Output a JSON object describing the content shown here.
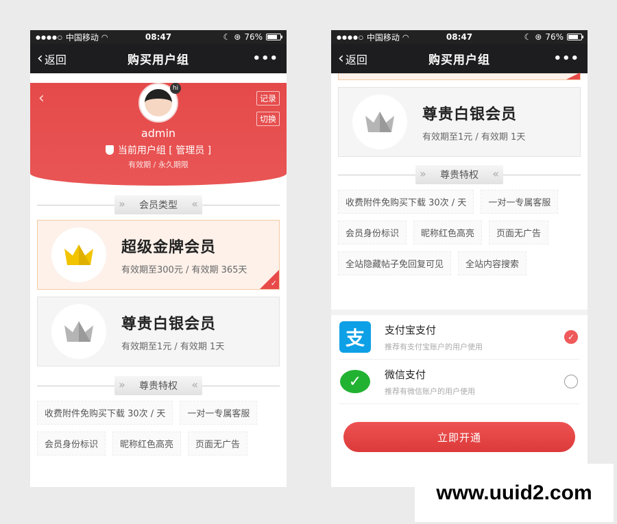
{
  "status": {
    "dots": "●●●●○",
    "carrier": "中国移动",
    "time": "08:47",
    "battery_text": "76%",
    "battery_level": 0.76
  },
  "navbar": {
    "back_label": "返回",
    "title": "购买用户组",
    "more": "•••"
  },
  "profile": {
    "username": "admin",
    "record_label": "记录",
    "switch_label": "切换",
    "avatar_badge": "hi",
    "current_group": "当前用户组 [ 管理员 ]",
    "validity": "有效期 / 永久期限"
  },
  "sections": {
    "member_type": "会员类型",
    "privileges": "尊贵特权"
  },
  "plans": [
    {
      "name": "超级金牌会员",
      "desc": "有效期至300元 / 有效期 365天",
      "crown_color": "#f2c400",
      "selected": true
    },
    {
      "name": "尊贵白银会员",
      "desc": "有效期至1元 / 有效期 1天",
      "crown_color": "#a9a9a9",
      "selected": false
    }
  ],
  "privileges": [
    "收费附件免购买下载 30次 / 天",
    "一对一专属客服",
    "会员身份标识",
    "昵称红色高亮",
    "页面无广告",
    "全站隐藏帖子免回复可见",
    "全站内容搜索"
  ],
  "payments": [
    {
      "name": "支付宝支付",
      "sub": "推荐有支付宝账户的用户使用",
      "icon": "alipay-icon",
      "checked": true
    },
    {
      "name": "微信支付",
      "sub": "推荐有微信账户的用户使用",
      "icon": "wechat-icon",
      "checked": false
    }
  ],
  "submit_label": "立即开通",
  "watermark": "www.uuid2.com",
  "colors": {
    "brand_red": "#e84a4a",
    "gold": "#f2c400",
    "silver": "#a9a9a9",
    "alipay": "#0ea0e6",
    "wechat": "#22b232"
  }
}
